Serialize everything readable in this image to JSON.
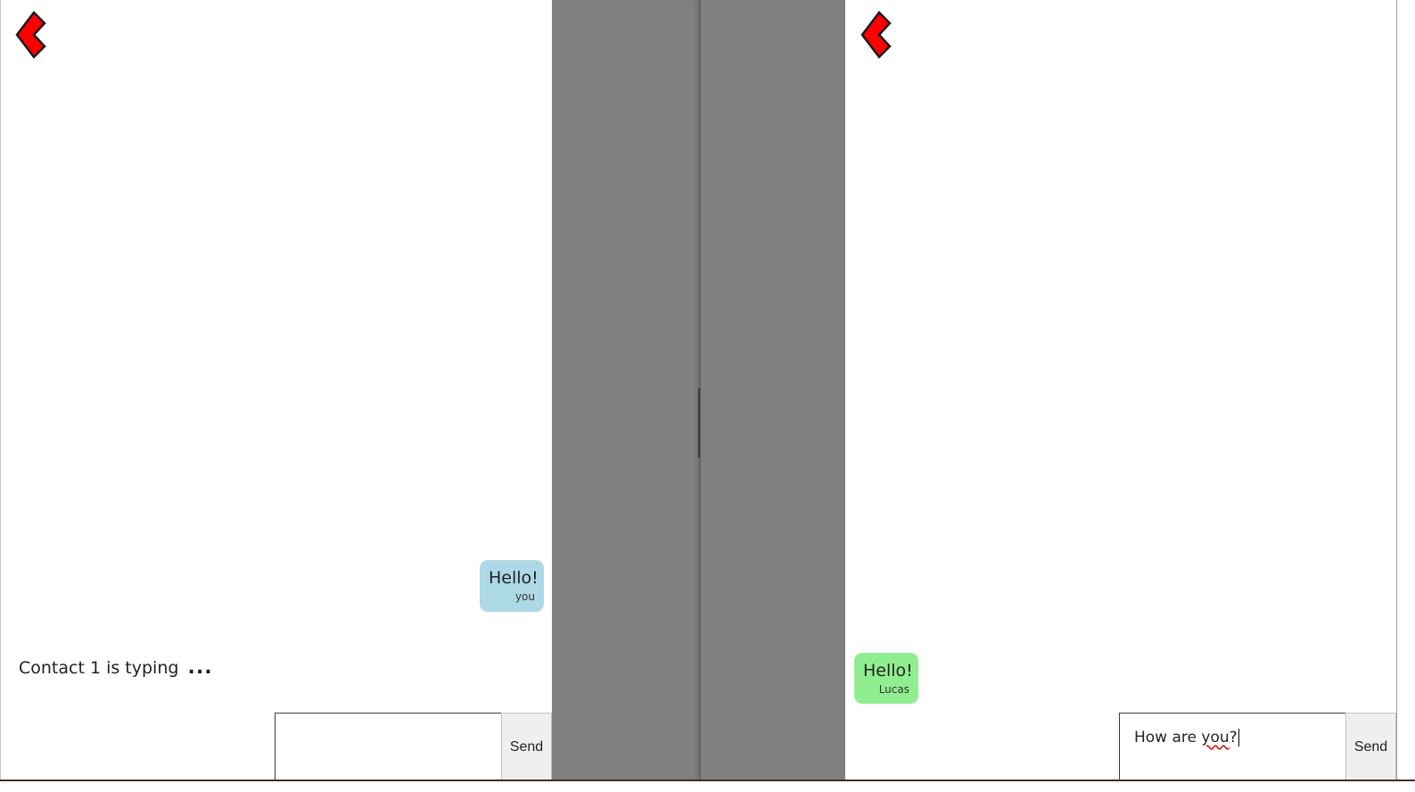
{
  "left_chat": {
    "back_icon": "back-chevron-icon",
    "messages": [
      {
        "text": "Hello!",
        "author": "you",
        "color": "#add8e6"
      }
    ],
    "typing_label": "Contact 1 is typing",
    "typing_dots": "...",
    "composer": {
      "value": "",
      "placeholder": "",
      "send_label": "Send"
    }
  },
  "right_chat": {
    "back_icon": "back-chevron-icon",
    "messages": [
      {
        "text": "Hello!",
        "author": "Lucas",
        "color": "#90ee90"
      }
    ],
    "composer": {
      "value_prefix": "How are ",
      "value_misspelled": "you",
      "value_suffix": "?",
      "send_label": "Send"
    }
  },
  "colors": {
    "divider": "#808080",
    "back_icon_fill": "#ff0000",
    "send_button_bg": "#efefef"
  }
}
